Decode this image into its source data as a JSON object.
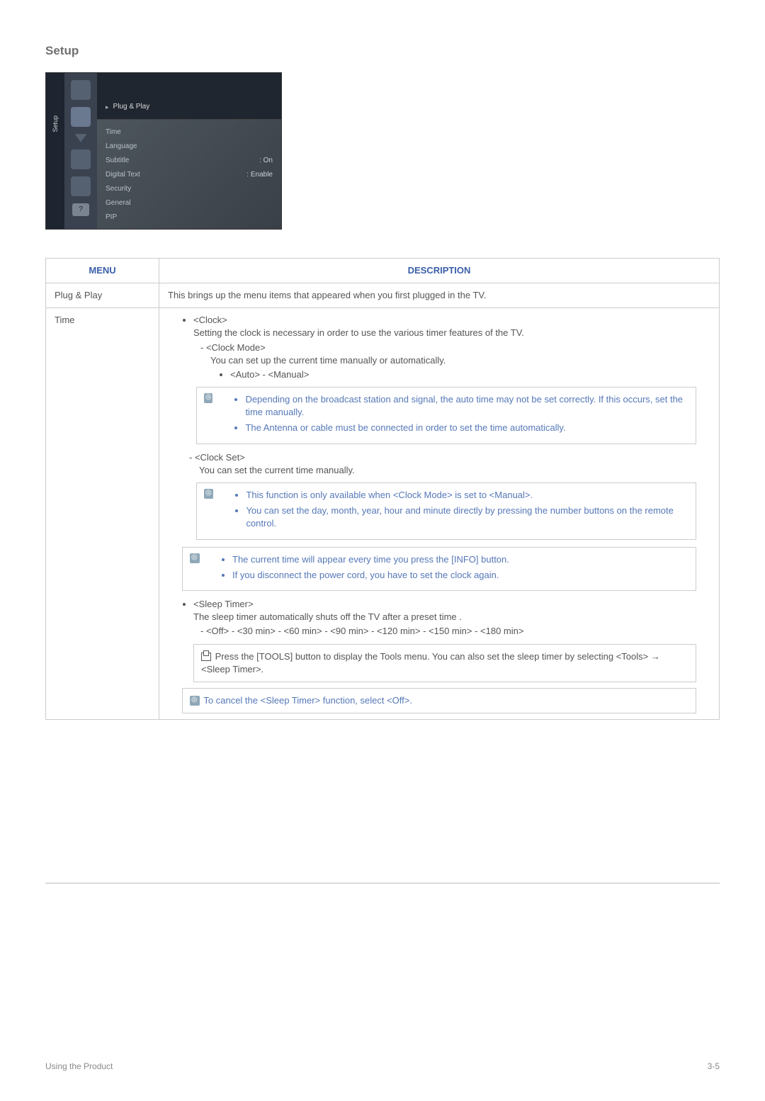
{
  "section_title": "Setup",
  "tv": {
    "sidebar_label": "Setup",
    "header_item": "Plug & Play",
    "rows": [
      {
        "label": "Time",
        "val": ""
      },
      {
        "label": "Language",
        "val": ""
      },
      {
        "label": "Subtitle",
        "val": ": On"
      },
      {
        "label": "Digital Text",
        "val": ": Enable"
      },
      {
        "label": "Security",
        "val": ""
      },
      {
        "label": "General",
        "val": ""
      },
      {
        "label": "PIP",
        "val": ""
      }
    ]
  },
  "table": {
    "headers": {
      "menu": "MENU",
      "desc": "DESCRIPTION"
    },
    "rows": {
      "plug_play": {
        "menu": "Plug & Play",
        "desc": "This brings up the menu items that appeared when you first plugged in the TV."
      },
      "time": {
        "menu": "Time"
      }
    }
  },
  "time": {
    "clock": {
      "title": "<Clock>",
      "desc": "Setting the clock is necessary in order to use the various timer features of the TV.",
      "mode_title": "<Clock Mode>",
      "mode_desc": "You can set up the current time manually or automatically.",
      "mode_opts": "<Auto> - <Manual>",
      "note1": "Depending on the broadcast station and signal, the auto time may not be set correctly. If this occurs, set the time manually.",
      "note2": "The Antenna or cable must be connected in order to set the time automatically.",
      "set_title": "<Clock Set>",
      "set_desc": "You can set the current time manually.",
      "set_note1": "This function is only available when <Clock Mode> is set to <Manual>.",
      "set_note2": "You can set the day, month, year, hour and minute directly by pressing the number buttons on the remote control."
    },
    "info": {
      "n1": "The current time will appear every time you press the [INFO] button.",
      "n2": "If you disconnect the power cord, you have to set the clock again."
    },
    "sleep": {
      "title": "<Sleep Timer>",
      "desc": "The sleep timer automatically shuts off the TV after a preset time .",
      "opts": "<Off> - <30 min> - <60 min> - <90 min> - <120 min> - <150 min> - <180 min>",
      "tools": "Press the [TOOLS] button to display the Tools menu. You can also set the sleep timer by selecting <Tools> → <Sleep Timer>.",
      "cancel": "To cancel the <Sleep Timer> function, select <Off>."
    }
  },
  "footer": {
    "left": "Using the Product",
    "right": "3-5"
  }
}
